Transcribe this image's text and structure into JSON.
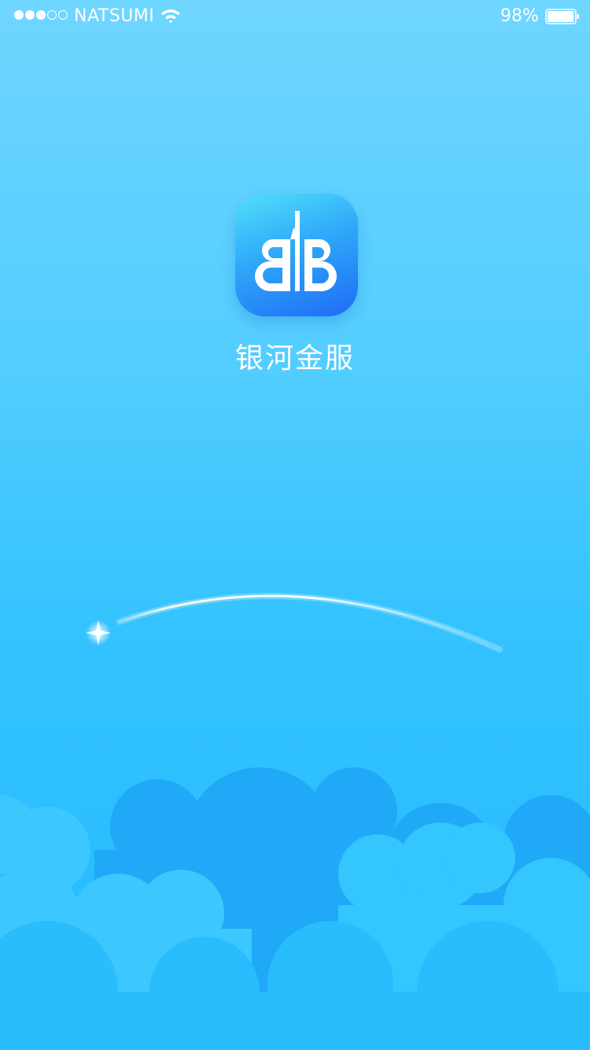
{
  "status_bar": {
    "signal_filled": 3,
    "signal_total": 5,
    "carrier": "NATSUMI",
    "wifi_icon": "wifi-icon",
    "battery_percent_label": "98%",
    "battery_level": 0.98
  },
  "splash": {
    "app_icon": "bb-logo-icon",
    "app_name": "银河金服",
    "decoration": "shooting-star-arc"
  },
  "colors": {
    "background_top": "#6fd6ff",
    "background_bottom": "#23b9ff",
    "icon_gradient_start": "#52e0fb",
    "icon_gradient_end": "#1f6cf5",
    "text": "#ffffff"
  }
}
